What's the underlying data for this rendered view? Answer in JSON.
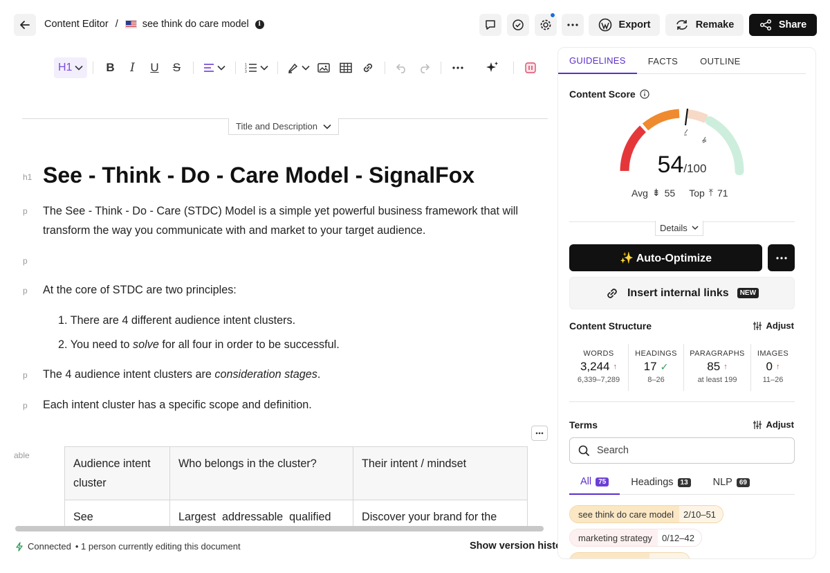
{
  "header": {
    "breadcrumb_root": "Content Editor",
    "breadcrumb_sep": "/",
    "doc_title": "see think do care model",
    "export_label": "Export",
    "remake_label": "Remake",
    "share_label": "Share",
    "icons": [
      "back-arrow-icon",
      "us-flag-icon",
      "info-icon",
      "comment-icon",
      "check-circle-icon",
      "gear-icon",
      "more-icon",
      "wordpress-icon",
      "refresh-icon",
      "share-icon"
    ],
    "accent_dot_color": "#1d6fd8"
  },
  "toolbar": {
    "heading_label": "H1",
    "icons": [
      "bold-icon",
      "italic-icon",
      "underline-icon",
      "strikethrough-icon",
      "align-icon",
      "numbered-list-icon",
      "highlight-icon",
      "image-icon",
      "table-icon",
      "link-icon",
      "undo-icon",
      "redo-icon",
      "more-icon",
      "ai-sparkle-icon",
      "pause-icon"
    ]
  },
  "editor": {
    "section_toggle": "Title and Description",
    "h1_marker": "h1",
    "p_marker": "p",
    "table_marker": "able",
    "title": "See - Think - Do - Care Model - SignalFox",
    "para1_line1": "The See - Think - Do - Care (STDC) Model is a simple yet powerful business framework that will",
    "para1_line2": "transform the way you communicate with and market to your target audience.",
    "para2": "At the core of STDC are two principles:",
    "list1": "1. There are 4 different audience intent clusters.",
    "list2_pre": "2. You need to ",
    "list2_em": "solve",
    "list2_post": " for all four in order to be successful.",
    "para3_pre": "The 4 audience intent clusters are ",
    "para3_em": "consideration stages",
    "para3_post": ".",
    "para4": "Each intent cluster has a specific scope and definition.",
    "table": {
      "headers": [
        "Audience intent cluster",
        "Who belongs in the cluster?",
        "Their intent / mindset"
      ],
      "row1": [
        "See",
        "Largest  addressable  qualified",
        "Discover your brand for the"
      ]
    }
  },
  "status": {
    "connected": "Connected",
    "editing": "• 1 person currently editing this document",
    "version_history": "Show version history"
  },
  "panel": {
    "tabs": [
      "GUIDELINES",
      "FACTS",
      "OUTLINE"
    ],
    "content_score_title": "Content Score",
    "score": "54",
    "score_max": "/100",
    "score_value": 54,
    "avg_label": "Avg",
    "avg_value": "55",
    "top_label": "Top",
    "top_value": "71",
    "details_label": "Details",
    "auto_optimize": "✨ Auto-Optimize",
    "insert_links": "Insert internal links",
    "new_tag": "NEW",
    "structure_title": "Content Structure",
    "adjust_label": "Adjust",
    "stats": [
      {
        "label": "WORDS",
        "value": "3,244",
        "range": "6,339–7,289",
        "status": "up"
      },
      {
        "label": "HEADINGS",
        "value": "17",
        "range": "8–26",
        "status": "ok"
      },
      {
        "label": "PARAGRAPHS",
        "value": "85",
        "range": "at least 199",
        "status": "up"
      },
      {
        "label": "IMAGES",
        "value": "0",
        "range": "11–26",
        "status": "up"
      }
    ],
    "terms_title": "Terms",
    "search_placeholder": "Search",
    "term_tabs": [
      {
        "label": "All",
        "count": "75"
      },
      {
        "label": "Headings",
        "count": "13"
      },
      {
        "label": "NLP",
        "count": "69"
      }
    ],
    "terms": [
      {
        "term": "see think do care model",
        "count": "2/10–51"
      },
      {
        "term": "marketing strategy",
        "count": "0/12–42"
      }
    ],
    "colors": {
      "accent": "#5b2fc9",
      "gauge_red": "#e5373a",
      "gauge_orange": "#ef8a2f",
      "gauge_peach": "#f7d9c7",
      "gauge_green": "#cdeedd"
    }
  }
}
